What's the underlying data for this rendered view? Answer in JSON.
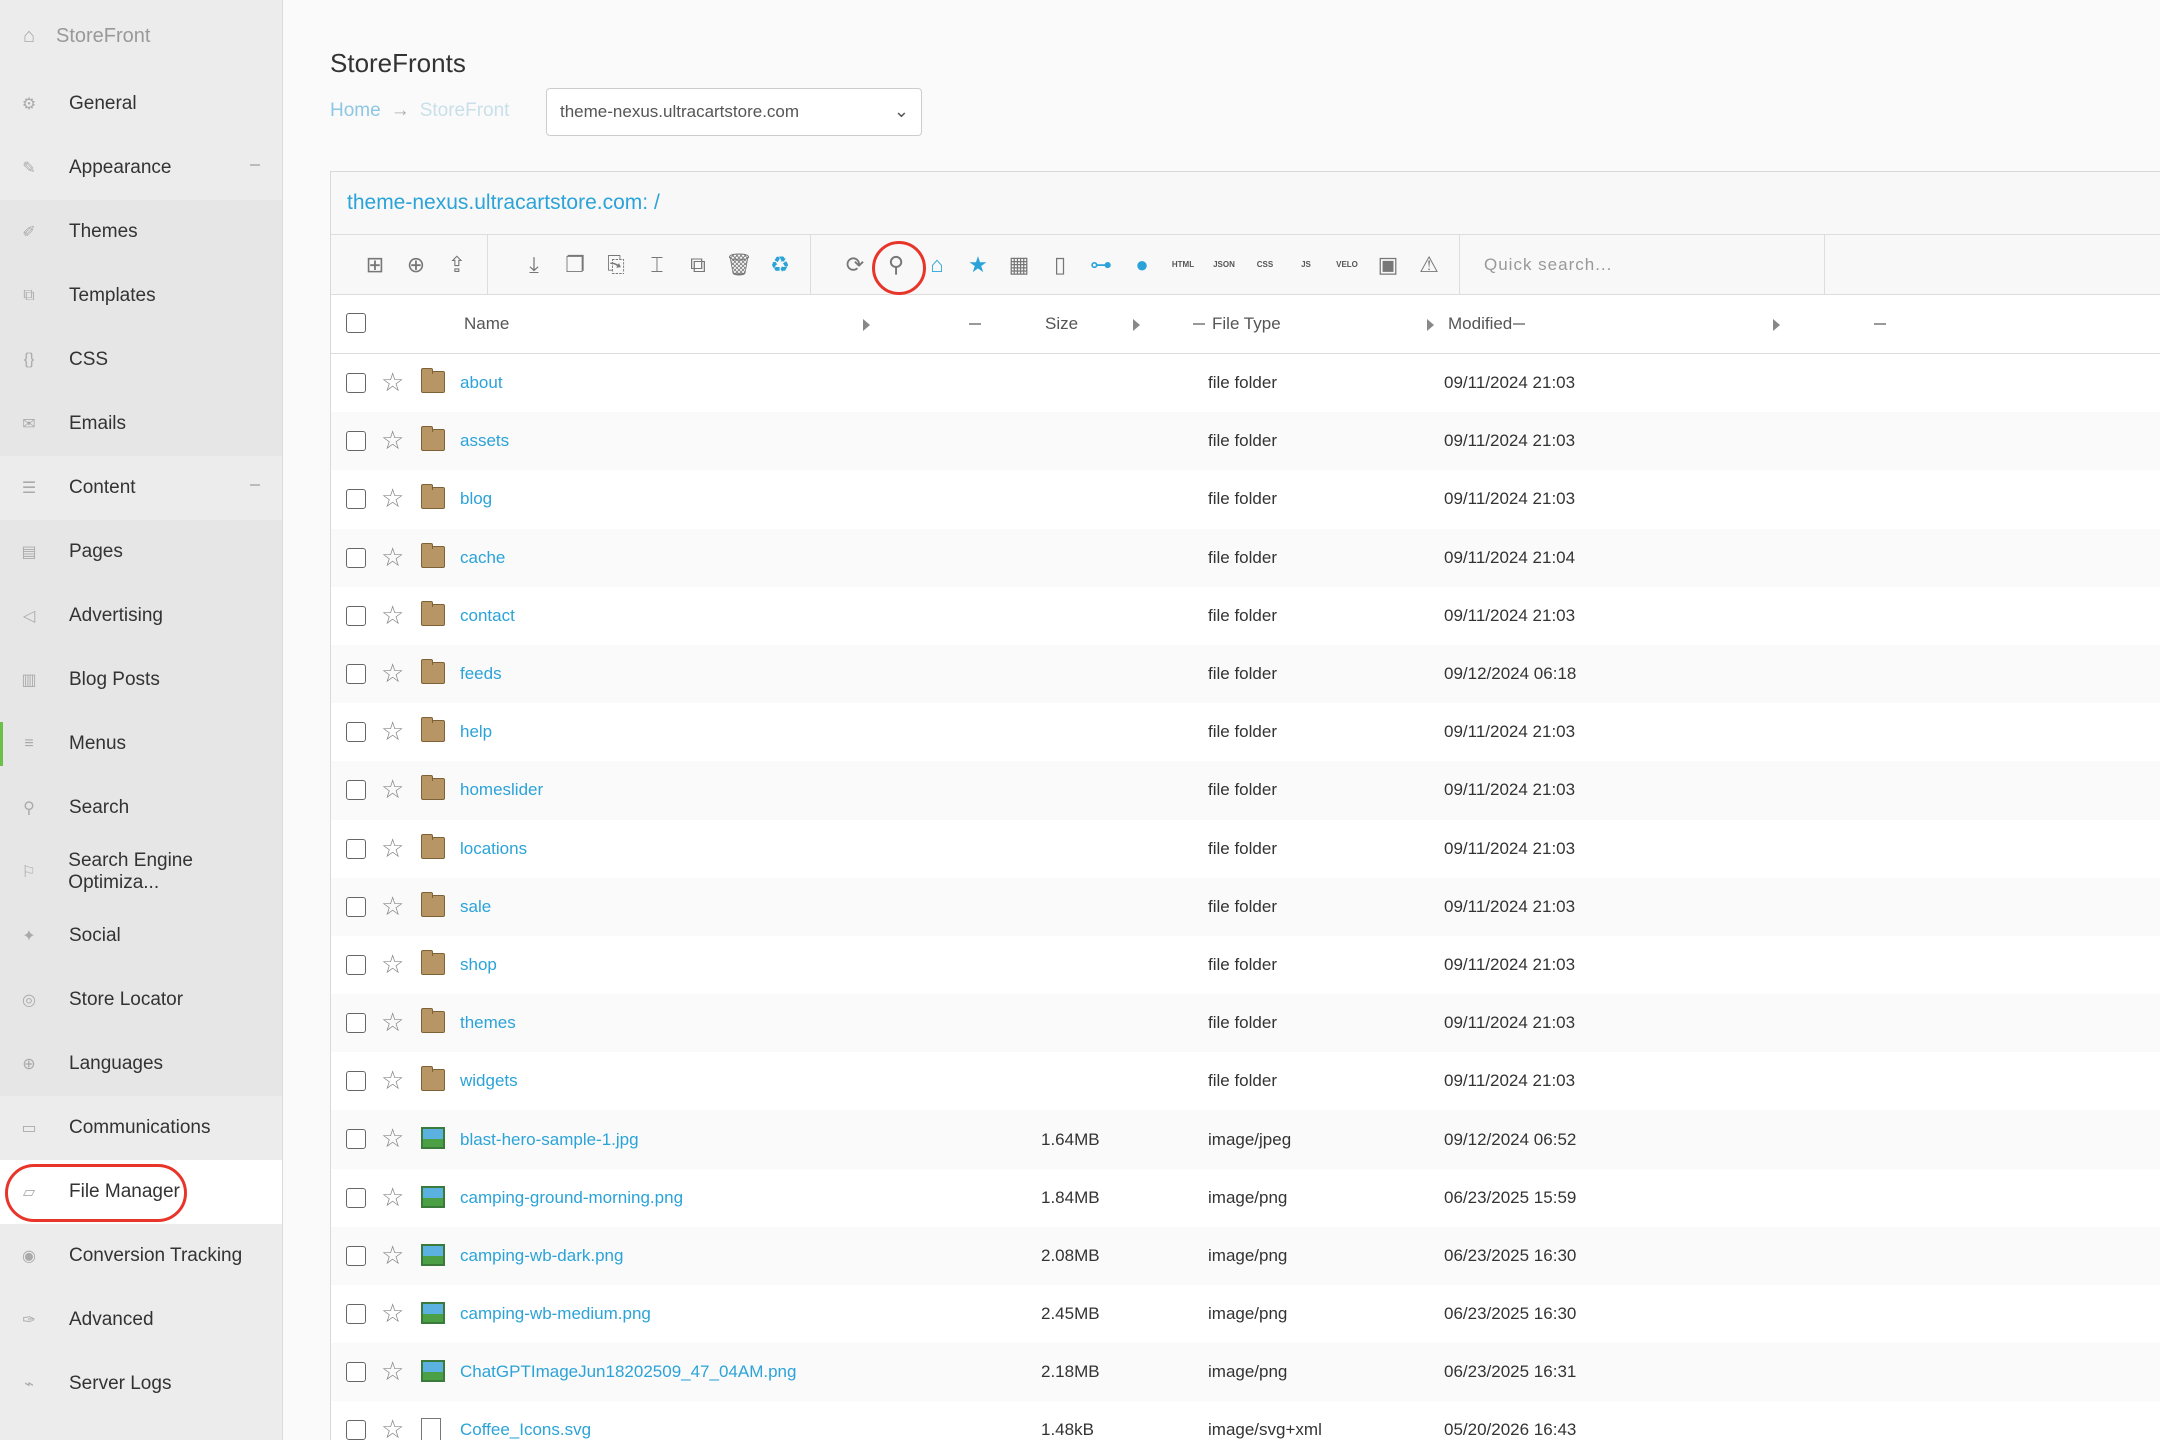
{
  "sidebar": {
    "header": "StoreFront",
    "items": [
      {
        "label": "General",
        "icon": "gear-icon",
        "glyph": "⚙",
        "group": false
      },
      {
        "label": "Appearance",
        "icon": "pencil-icon",
        "glyph": "✎",
        "group": false,
        "collapse": true
      },
      {
        "label": "Themes",
        "icon": "brush-icon",
        "glyph": "✐",
        "group": true
      },
      {
        "label": "Templates",
        "icon": "templates-icon",
        "glyph": "⧉",
        "group": true
      },
      {
        "label": "CSS",
        "icon": "braces-icon",
        "glyph": "{}",
        "group": true
      },
      {
        "label": "Emails",
        "icon": "envelope-icon",
        "glyph": "✉",
        "group": true
      },
      {
        "label": "Content",
        "icon": "sliders-icon",
        "glyph": "☰",
        "group": false,
        "collapse": true
      },
      {
        "label": "Pages",
        "icon": "pages-icon",
        "glyph": "▤",
        "group": true
      },
      {
        "label": "Advertising",
        "icon": "megaphone-icon",
        "glyph": "◁",
        "group": true
      },
      {
        "label": "Blog Posts",
        "icon": "book-icon",
        "glyph": "▥",
        "group": true
      },
      {
        "label": "Menus",
        "icon": "menu-icon",
        "glyph": "≡",
        "group": true
      },
      {
        "label": "Search",
        "icon": "search-icon",
        "glyph": "⚲",
        "group": true
      },
      {
        "label": "Search Engine Optimiza...",
        "icon": "flag-icon",
        "glyph": "⚐",
        "group": true
      },
      {
        "label": "Social",
        "icon": "twitter-icon",
        "glyph": "✦",
        "group": true
      },
      {
        "label": "Store Locator",
        "icon": "map-pin-icon",
        "glyph": "◎",
        "group": true
      },
      {
        "label": "Languages",
        "icon": "globe-icon",
        "glyph": "⊕",
        "group": true
      },
      {
        "label": "Communications",
        "icon": "chat-icon",
        "glyph": "▭",
        "group": false
      },
      {
        "label": "File Manager",
        "icon": "folder-icon",
        "glyph": "▱",
        "group": false,
        "active": true
      },
      {
        "label": "Conversion Tracking",
        "icon": "eye-icon",
        "glyph": "◉",
        "group": false
      },
      {
        "label": "Advanced",
        "icon": "wrench-icon",
        "glyph": "✑",
        "group": false
      },
      {
        "label": "Server Logs",
        "icon": "pulse-icon",
        "glyph": "⌁",
        "group": false
      }
    ]
  },
  "main": {
    "title": "StoreFronts",
    "breadcrumb": {
      "home": "Home",
      "separator": "→",
      "current": "StoreFront"
    },
    "store_select": {
      "value": "theme-nexus.ultracartstore.com"
    }
  },
  "file_manager": {
    "path": "theme-nexus.ultracartstore.com: /",
    "search_placeholder": "Quick search...",
    "columns": {
      "name": "Name",
      "size": "Size",
      "type": "File Type",
      "modified": "Modified"
    },
    "rows": [
      {
        "name": "about",
        "size": "",
        "type": "file folder",
        "modified": "09/11/2024 21:03",
        "kind": "folder"
      },
      {
        "name": "assets",
        "size": "",
        "type": "file folder",
        "modified": "09/11/2024 21:03",
        "kind": "folder"
      },
      {
        "name": "blog",
        "size": "",
        "type": "file folder",
        "modified": "09/11/2024 21:03",
        "kind": "folder"
      },
      {
        "name": "cache",
        "size": "",
        "type": "file folder",
        "modified": "09/11/2024 21:04",
        "kind": "folder"
      },
      {
        "name": "contact",
        "size": "",
        "type": "file folder",
        "modified": "09/11/2024 21:03",
        "kind": "folder"
      },
      {
        "name": "feeds",
        "size": "",
        "type": "file folder",
        "modified": "09/12/2024 06:18",
        "kind": "folder"
      },
      {
        "name": "help",
        "size": "",
        "type": "file folder",
        "modified": "09/11/2024 21:03",
        "kind": "folder"
      },
      {
        "name": "homeslider",
        "size": "",
        "type": "file folder",
        "modified": "09/11/2024 21:03",
        "kind": "folder"
      },
      {
        "name": "locations",
        "size": "",
        "type": "file folder",
        "modified": "09/11/2024 21:03",
        "kind": "folder"
      },
      {
        "name": "sale",
        "size": "",
        "type": "file folder",
        "modified": "09/11/2024 21:03",
        "kind": "folder"
      },
      {
        "name": "shop",
        "size": "",
        "type": "file folder",
        "modified": "09/11/2024 21:03",
        "kind": "folder"
      },
      {
        "name": "themes",
        "size": "",
        "type": "file folder",
        "modified": "09/11/2024 21:03",
        "kind": "folder"
      },
      {
        "name": "widgets",
        "size": "",
        "type": "file folder",
        "modified": "09/11/2024 21:03",
        "kind": "folder"
      },
      {
        "name": "blast-hero-sample-1.jpg",
        "size": "1.64MB",
        "type": "image/jpeg",
        "modified": "09/12/2024 06:52",
        "kind": "image"
      },
      {
        "name": "camping-ground-morning.png",
        "size": "1.84MB",
        "type": "image/png",
        "modified": "06/23/2025 15:59",
        "kind": "image"
      },
      {
        "name": "camping-wb-dark.png",
        "size": "2.08MB",
        "type": "image/png",
        "modified": "06/23/2025 16:30",
        "kind": "image"
      },
      {
        "name": "camping-wb-medium.png",
        "size": "2.45MB",
        "type": "image/png",
        "modified": "06/23/2025 16:30",
        "kind": "image"
      },
      {
        "name": "ChatGPTImageJun18202509_47_04AM.png",
        "size": "2.18MB",
        "type": "image/png",
        "modified": "06/23/2025 16:31",
        "kind": "image"
      },
      {
        "name": "Coffee_Icons.svg",
        "size": "1.48kB",
        "type": "image/svg+xml",
        "modified": "05/20/2026 16:43",
        "kind": "doc"
      }
    ]
  },
  "colors": {
    "accent": "#2ba3d8",
    "highlight": "#e8352a",
    "folder": "#b89564"
  }
}
